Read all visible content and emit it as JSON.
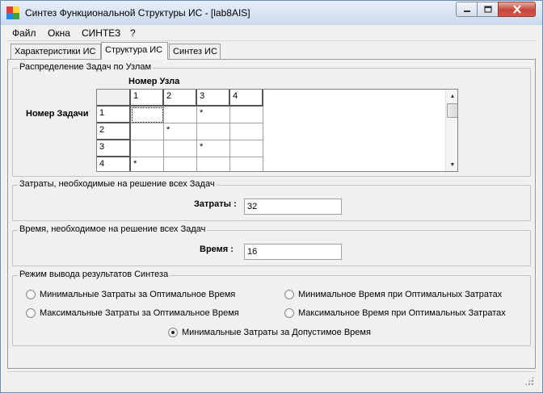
{
  "window": {
    "title": "Синтез Функциональной Структуры ИС - [lab8AIS]",
    "icons": {
      "app": "colored-blocks-icon",
      "minimize": "minimize-icon",
      "maximize": "maximize-icon",
      "close": "close-icon"
    }
  },
  "menu": [
    "Файл",
    "Окна",
    "СИНТЕЗ",
    "?"
  ],
  "tabs": [
    {
      "label": "Характеристики ИС",
      "active": false
    },
    {
      "label": "Структура ИС",
      "active": true
    },
    {
      "label": "Синтез ИС",
      "active": false
    }
  ],
  "distribution": {
    "group_title": "Распределение Задач по Узлам",
    "col_axis_label": "Номер Узла",
    "row_axis_label": "Номер Задачи",
    "columns": [
      "1",
      "2",
      "3",
      "4"
    ],
    "rows": [
      {
        "label": "1",
        "cells": [
          "",
          "",
          "*",
          ""
        ]
      },
      {
        "label": "2",
        "cells": [
          "",
          "*",
          "",
          ""
        ]
      },
      {
        "label": "3",
        "cells": [
          "",
          "",
          "*",
          ""
        ]
      },
      {
        "label": "4",
        "cells": [
          "*",
          "",
          "",
          ""
        ]
      }
    ]
  },
  "costs": {
    "group_title": "Затраты, необходимые на решение всех Задач",
    "label": "Затраты :",
    "value": "32"
  },
  "time": {
    "group_title": "Время, необходимое на решение всех Задач",
    "label": "Время :",
    "value": "16"
  },
  "mode": {
    "group_title": "Режим вывода результатов Синтеза",
    "options": [
      {
        "label": "Минимальные Затраты за Оптимальное Время",
        "selected": false
      },
      {
        "label": "Минимальное Время при Оптимальных Затратах",
        "selected": false
      },
      {
        "label": "Максимальные Затраты за Оптимальное Время",
        "selected": false
      },
      {
        "label": "Максимальное Время при Оптимальных Затратах",
        "selected": false
      },
      {
        "label": "Минимальные Затраты за Допустимое  Время",
        "selected": true
      }
    ]
  }
}
